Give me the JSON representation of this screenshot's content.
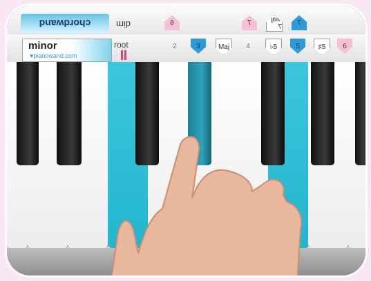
{
  "chord": {
    "name": "minor",
    "brand": "♥pianowand.com",
    "root_label": "root"
  },
  "top_bar": {
    "logo_mirrored": "chordwand",
    "dim_mirrored": "dim",
    "badges": [
      "6",
      "7",
      "Maj 7",
      "7"
    ]
  },
  "degrees": [
    "2",
    "3",
    "Maj",
    "4",
    "♭5",
    "5",
    "♯5",
    "6"
  ],
  "colors": {
    "highlight_cyan": "#2fc0d9",
    "degree_blue": "#2e9ad6",
    "degree_pink": "#f8bfd6",
    "background_pink": "#fbe7f3"
  }
}
